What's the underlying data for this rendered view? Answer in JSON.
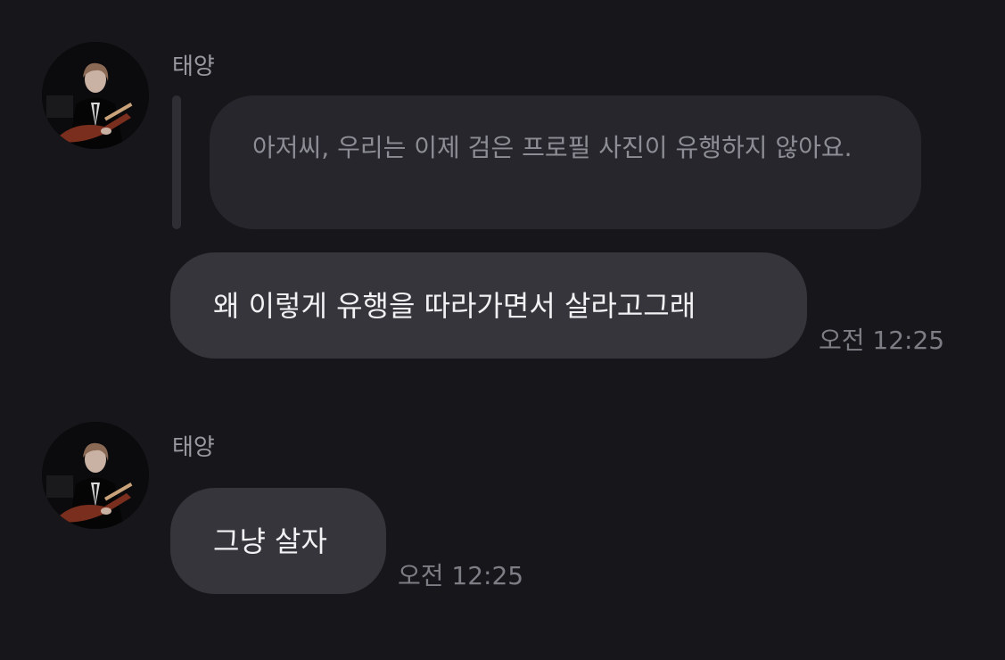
{
  "messages": [
    {
      "sender": "태양",
      "quoted_text": "아저씨, 우리는 이제 검은 프로필 사진이 유행하지 않아요.",
      "text": "왜 이렇게 유행을 따라가면서 살라고그래",
      "time": "오전 12:25"
    },
    {
      "sender": "태양",
      "text": "그냥 살자",
      "time": "오전 12:25"
    }
  ],
  "colors": {
    "background": "#17171b",
    "bubble": "#35353b",
    "quote_bubble": "#26262c",
    "quote_bar": "#2e2e34",
    "text": "#f2f2f4",
    "muted_text": "#8d8d95"
  },
  "icons": {
    "avatar": "profile-photo-person-with-guitar"
  }
}
